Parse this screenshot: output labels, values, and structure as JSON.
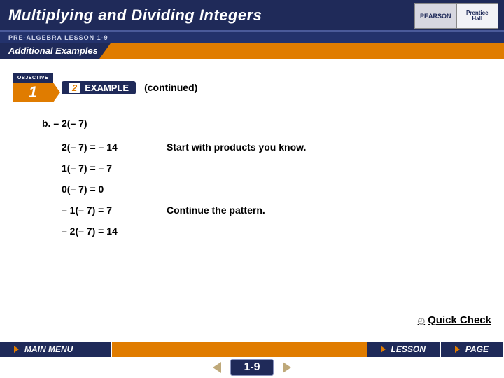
{
  "header": {
    "title": "Multiplying and Dividing Integers",
    "subtitle": "PRE-ALGEBRA LESSON 1-9",
    "additional_examples": "Additional Examples",
    "publisher_left": "PEARSON",
    "publisher_right1": "Prentice",
    "publisher_right2": "Hall"
  },
  "objective": {
    "label": "OBJECTIVE",
    "number": "1"
  },
  "example": {
    "number": "2",
    "label": "EXAMPLE",
    "continued": "(continued)"
  },
  "problem": {
    "letter": "b.",
    "expr": "– 2(– 7)"
  },
  "work": [
    {
      "expr": "2(– 7) = – 14",
      "note": "Start with products you know."
    },
    {
      "expr": "1(– 7) = – 7",
      "note": ""
    },
    {
      "expr": "0(– 7) = 0",
      "note": ""
    },
    {
      "expr": "– 1(– 7) = 7",
      "note": "Continue the pattern."
    },
    {
      "expr": "– 2(– 7) = 14",
      "note": ""
    }
  ],
  "quick_check": "Quick Check",
  "nav": {
    "main_menu": "MAIN MENU",
    "lesson": "LESSON",
    "page": "PAGE",
    "lesson_number": "1-9"
  }
}
